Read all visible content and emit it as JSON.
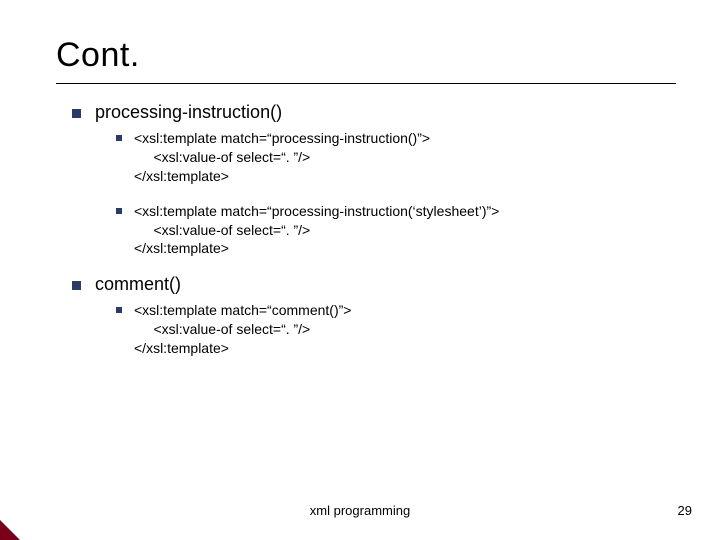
{
  "title": "Cont.",
  "sections": [
    {
      "heading": "processing-instruction()",
      "items": [
        "<xsl:template match=“processing-instruction()”>\n     <xsl:value-of select=“. ”/>\n</xsl:template>",
        "<xsl:template match=“processing-instruction(‘stylesheet’)”>\n     <xsl:value-of select=“. ”/>\n</xsl:template>"
      ]
    },
    {
      "heading": "comment()",
      "items": [
        "<xsl:template match=“comment()”>\n     <xsl:value-of select=“. ”/>\n</xsl:template>"
      ]
    }
  ],
  "footer": {
    "center": "xml programming",
    "page": "29"
  }
}
